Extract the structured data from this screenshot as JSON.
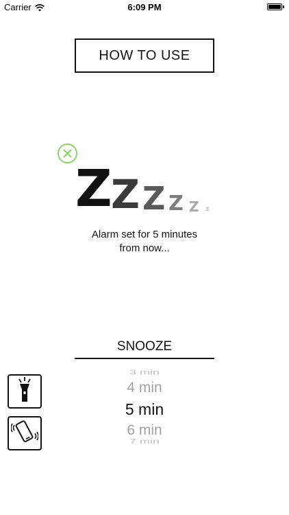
{
  "status_bar": {
    "carrier": "Carrier",
    "time": "6:09 PM",
    "wifi_icon": "wifi-icon",
    "battery_icon": "battery-full-icon"
  },
  "how_to_use": {
    "label": "HOW TO USE"
  },
  "cancel": {
    "icon": "close-circle-icon",
    "color": "#8BD36A"
  },
  "zzz": {
    "letters": [
      "Z",
      "Z",
      "Z",
      "Z",
      "Z",
      "z"
    ]
  },
  "alarm_message": {
    "line1": "Alarm set for 5 minutes",
    "line2": "from now..."
  },
  "snooze": {
    "title": "SNOOZE",
    "options": [
      "3 min",
      "4 min",
      "5 min",
      "6 min",
      "7 min"
    ],
    "selected": "5 min"
  },
  "side_buttons": {
    "flashlight_icon": "flashlight-icon",
    "vibrate_icon": "vibrate-phone-icon"
  }
}
